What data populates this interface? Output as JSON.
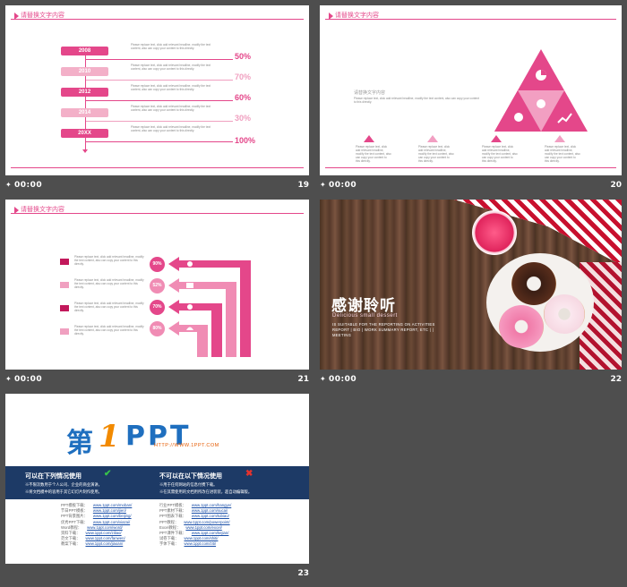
{
  "colors": {
    "accent": "#e4478a",
    "light": "#f0a0c0",
    "bg": "#4e4e4e"
  },
  "header_title": "请替换文字内容",
  "lorem": "Please replace text, click add relevant headline, modify the text content, also can copy your content to this directly.",
  "slides": [
    {
      "number": "19",
      "time": "00:00",
      "years": [
        "2008",
        "2010",
        "2012",
        "2014",
        "20XX"
      ],
      "percents": [
        "50%",
        "70%",
        "60%",
        "30%",
        "100%"
      ]
    },
    {
      "number": "20",
      "time": "00:00",
      "subtitle": "请替换文字内容",
      "icons": [
        "pie-icon",
        "trophy-icon",
        "lightbulb-icon",
        "chart-icon"
      ]
    },
    {
      "number": "21",
      "time": "00:00",
      "percents": [
        "90%",
        "52%",
        "70%",
        "80%"
      ]
    },
    {
      "number": "22",
      "time": "00:00",
      "title": "感谢聆听",
      "subtitle": "Delicious small dessert",
      "desc": "IS SUITABLE FOR THE REPORTING ON ACTIVITIES REPORT | BIO | WORK SUMMARY REPORT, ETC | | MEETING"
    },
    {
      "number": "23",
      "time": "00:00",
      "logo_cn": "第",
      "logo_one": "1",
      "logo_ppt": "PPT",
      "logo_url": "HTTP://WWW.1PPT.COM",
      "can_title": "可以在下列情况使用",
      "cannot_title": "不可以在以下情况使用",
      "can_items": [
        "※不限次数用于个人公司、企业的商业演讲。",
        "※将文档模中的容用于其它幻灯片制作使用。"
      ],
      "cannot_items": [
        "※用于任何网站的信息付费下载。",
        "※在其需使用的文档用所改在进装装，超自动编辑版。"
      ],
      "links_left": [
        {
          "label": "PPT模板下载：",
          "url": "www.1ppt.com/moban/"
        },
        {
          "label": "节日PPT模板：",
          "url": "www.1ppt.com/jieri/"
        },
        {
          "label": "PPT背景图片：",
          "url": "www.1ppt.com/beijing/"
        },
        {
          "label": "优秀PPT下载：",
          "url": "www.1ppt.com/xiazai/"
        },
        {
          "label": "Word教程：",
          "url": "www.1ppt.com/word/"
        },
        {
          "label": "资料下载：",
          "url": "www.1ppt.com/ziliao/"
        },
        {
          "label": "范文下载：",
          "url": "www.1ppt.com/fanwen/"
        },
        {
          "label": "教案下载：",
          "url": "www.1ppt.com/jiaoan/"
        }
      ],
      "links_right": [
        {
          "label": "行业PPT模板：",
          "url": "www.1ppt.com/hangye/"
        },
        {
          "label": "PPT素材下载：",
          "url": "www.1ppt.com/sucai/"
        },
        {
          "label": "PPT图表下载：",
          "url": "www.1ppt.com/tubiao/"
        },
        {
          "label": "PPT教程：",
          "url": "www.1ppt.com/powerpoint/"
        },
        {
          "label": "Excel教程：",
          "url": "www.1ppt.com/excel/"
        },
        {
          "label": "PPT课件下载：",
          "url": "www.1ppt.com/kejian/"
        },
        {
          "label": "试卷下载：",
          "url": "www.1ppt.com/shiti/"
        },
        {
          "label": "字体下载：",
          "url": "www.1ppt.com/ziti/"
        }
      ]
    }
  ]
}
